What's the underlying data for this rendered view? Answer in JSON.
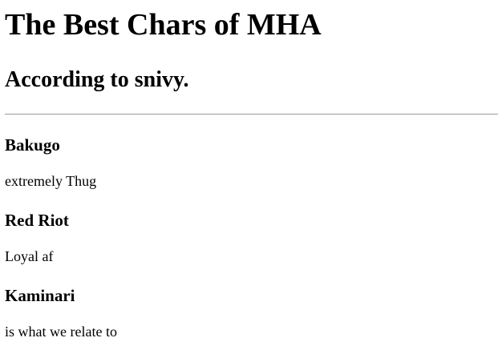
{
  "page": {
    "title": "The Best Chars of MHA",
    "subtitle": "According to snivy."
  },
  "characters": [
    {
      "name": "Bakugo",
      "description": "extremely Thug"
    },
    {
      "name": "Red Riot",
      "description": "Loyal af"
    },
    {
      "name": "Kaminari",
      "description": "is what we relate to"
    }
  ]
}
